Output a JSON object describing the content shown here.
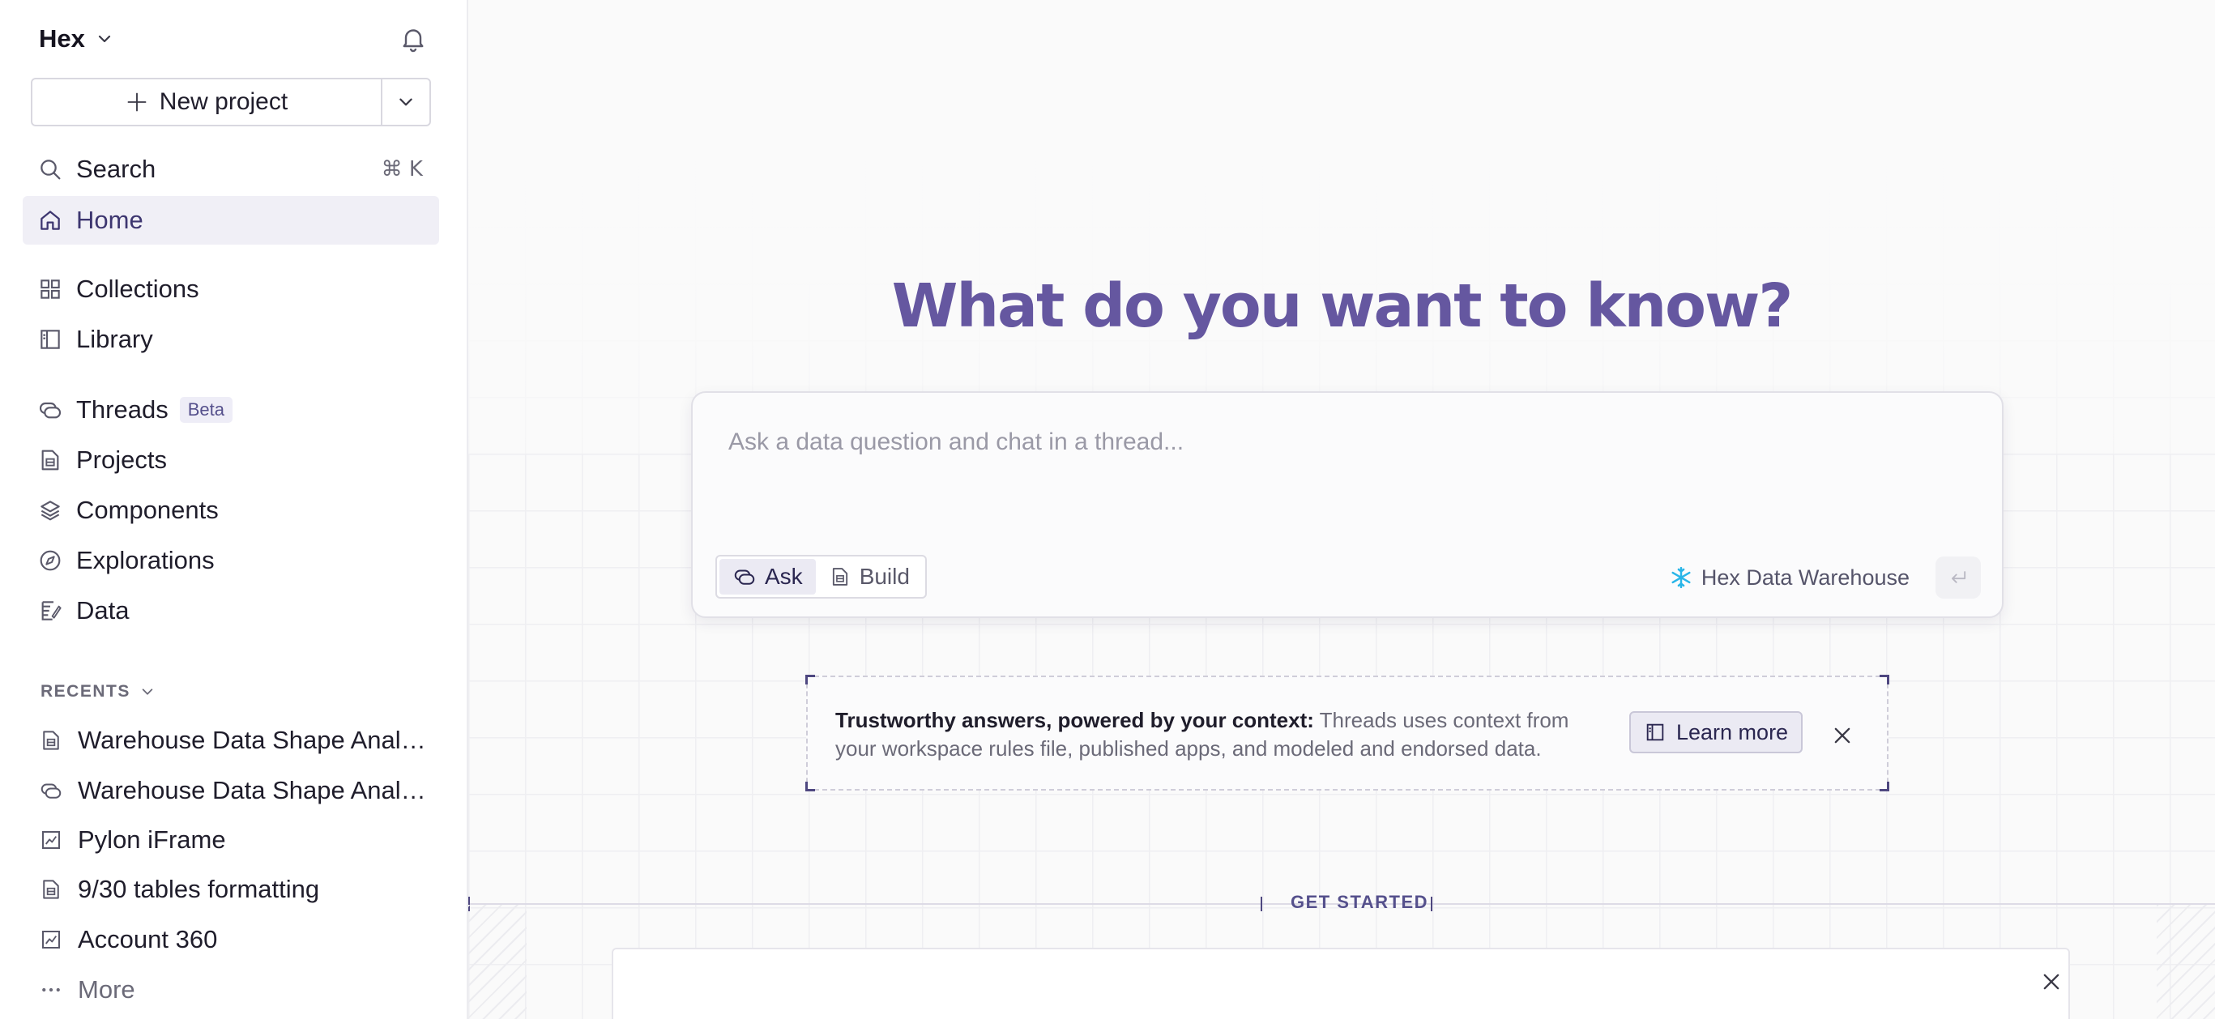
{
  "workspace": {
    "name": "Hex"
  },
  "new_project": {
    "label": "New project"
  },
  "nav": {
    "search": {
      "label": "Search",
      "shortcut": "⌘ K"
    },
    "home": {
      "label": "Home"
    },
    "collections": {
      "label": "Collections"
    },
    "library": {
      "label": "Library"
    },
    "threads": {
      "label": "Threads",
      "badge": "Beta"
    },
    "projects": {
      "label": "Projects"
    },
    "components": {
      "label": "Components"
    },
    "explorations": {
      "label": "Explorations"
    },
    "data": {
      "label": "Data"
    }
  },
  "recents": {
    "header": "RECENTS",
    "items": [
      {
        "label": "Warehouse Data Shape Analysis",
        "icon": "project-icon"
      },
      {
        "label": "Warehouse Data Shape Analysis",
        "icon": "thread-icon"
      },
      {
        "label": "Pylon iFrame",
        "icon": "app-chart-icon"
      },
      {
        "label": "9/30 tables formatting",
        "icon": "project-icon"
      },
      {
        "label": "Account 360",
        "icon": "app-chart-icon"
      }
    ],
    "more_label": "More"
  },
  "main": {
    "headline": "What do you want to know?",
    "ask_placeholder": "Ask a data question and chat in a thread...",
    "modes": [
      {
        "label": "Ask",
        "active": true
      },
      {
        "label": "Build",
        "active": false
      }
    ],
    "warehouse": "Hex Data Warehouse",
    "banner": {
      "title": "Trustworthy answers, powered by your context:",
      "body": "Threads uses context from your workspace rules file, published apps, and modeled and endorsed data.",
      "learn_more": "Learn more"
    },
    "get_started": "GET STARTED"
  },
  "colors": {
    "accent": "#6557a0",
    "active_nav_bg": "#f0eff6",
    "snowflake": "#29b5e8"
  }
}
